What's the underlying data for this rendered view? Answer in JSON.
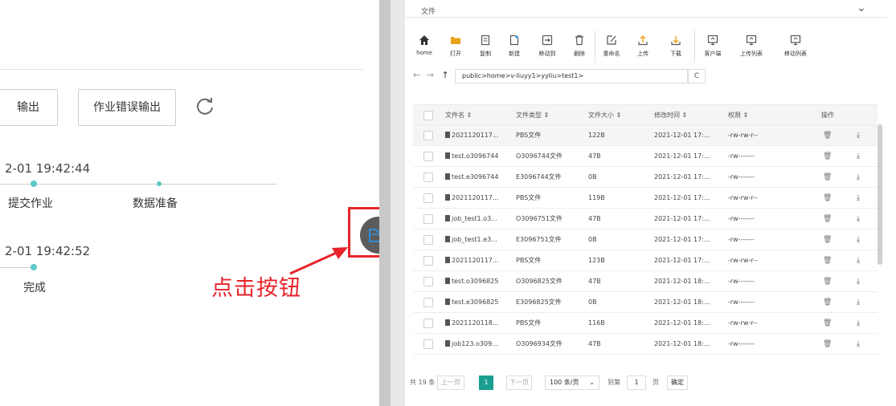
{
  "left": {
    "buttons": [
      "输出",
      "作业错误输出"
    ],
    "timeline1": {
      "timestamp": "2-01 19:42:44",
      "steps": [
        "提交作业",
        "数据准备"
      ]
    },
    "timeline2": {
      "timestamp": "2-01 19:42:52",
      "steps": [
        "完成"
      ]
    },
    "annotation": "点击按钮"
  },
  "file_manager": {
    "title": "文件",
    "toolbar": [
      {
        "label": "home",
        "icon": "home-icon"
      },
      {
        "label": "打开",
        "icon": "folder-icon"
      },
      {
        "label": "复制",
        "icon": "copy-icon"
      },
      {
        "label": "新建",
        "icon": "new-file-icon"
      },
      {
        "label": "移动到",
        "icon": "move-icon"
      },
      {
        "label": "删除",
        "icon": "trash-icon"
      },
      {
        "label": "重命名",
        "icon": "rename-icon"
      },
      {
        "label": "上传",
        "icon": "upload-icon"
      },
      {
        "label": "下载",
        "icon": "download-icon"
      },
      {
        "label": "客户端",
        "icon": "monitor-icon"
      },
      {
        "label": "上传列表",
        "icon": "monitor-icon"
      },
      {
        "label": "移动列表",
        "icon": "monitor-icon"
      }
    ],
    "path": "public>home>v-liuyy1>yyliu>test1>",
    "path_refresh": "C",
    "columns": [
      "文件名 ⇕",
      "文件类型 ⇕",
      "文件大小 ⇕",
      "修改时间 ⇕",
      "权限 ⇕",
      "操作"
    ],
    "rows": [
      {
        "name": "2021120117...",
        "type": "PBS文件",
        "size": "122B",
        "time": "2021-12-01 17:...",
        "perm": "-rw-rw-r--"
      },
      {
        "name": "test.o3096744",
        "type": "O3096744文件",
        "size": "47B",
        "time": "2021-12-01 17:...",
        "perm": "-rw-------"
      },
      {
        "name": "test.e3096744",
        "type": "E3096744文件",
        "size": "0B",
        "time": "2021-12-01 17:...",
        "perm": "-rw-------"
      },
      {
        "name": "2021120117...",
        "type": "PBS文件",
        "size": "119B",
        "time": "2021-12-01 17:...",
        "perm": "-rw-rw-r--"
      },
      {
        "name": "job_test1.o3...",
        "type": "O3096751文件",
        "size": "47B",
        "time": "2021-12-01 17:...",
        "perm": "-rw-------"
      },
      {
        "name": "job_test1.e3...",
        "type": "E3096751文件",
        "size": "0B",
        "time": "2021-12-01 17:...",
        "perm": "-rw-------"
      },
      {
        "name": "2021120117...",
        "type": "PBS文件",
        "size": "123B",
        "time": "2021-12-01 17:...",
        "perm": "-rw-rw-r--"
      },
      {
        "name": "test.o3096825",
        "type": "O3096825文件",
        "size": "47B",
        "time": "2021-12-01 18:...",
        "perm": "-rw-------"
      },
      {
        "name": "test.e3096825",
        "type": "E3096825文件",
        "size": "0B",
        "time": "2021-12-01 18:...",
        "perm": "-rw-------"
      },
      {
        "name": "2021120118...",
        "type": "PBS文件",
        "size": "116B",
        "time": "2021-12-01 18:...",
        "perm": "-rw-rw-r--"
      },
      {
        "name": "job123.o309...",
        "type": "O3096934文件",
        "size": "47B",
        "time": "2021-12-01 18:...",
        "perm": "-rw-------"
      }
    ],
    "pager": {
      "total": "共 19 条",
      "prev": "上一页",
      "current": "1",
      "next": "下一页",
      "page_size": "100 条/页",
      "goto_label": "到第",
      "goto_value": "1",
      "page_unit": "页",
      "confirm": "确定"
    }
  },
  "colors": {
    "accent": "#1a9e90",
    "timeline_dot": "#5ec8c8",
    "annotation": "#e8232a"
  }
}
